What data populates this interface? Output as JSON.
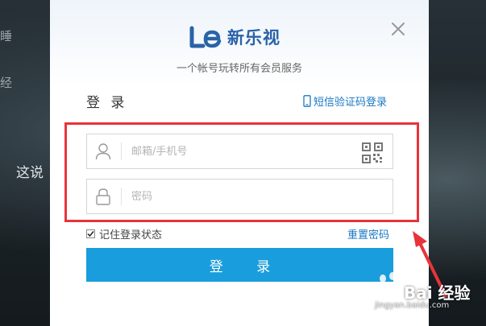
{
  "background": {
    "left_text_1": "睡",
    "left_text_2": "经",
    "subtitle": "这说"
  },
  "dialog": {
    "logo_text": "新乐视",
    "tagline": "一个帐号玩转所有会员服务",
    "login_title": "登 录",
    "sms_login": "短信验证码登录",
    "username": {
      "placeholder": "邮箱/手机号",
      "value": ""
    },
    "password": {
      "placeholder": "密码",
      "value": ""
    },
    "remember_label": "记住登录状态",
    "remember_checked": true,
    "reset_password": "重置密码",
    "login_button": "登 录"
  },
  "colors": {
    "accent": "#1a9ddc",
    "link": "#1a78c2",
    "highlight": "#e8333a",
    "brand": "#2a63a8"
  },
  "watermark": {
    "text": "Bai 经验",
    "url": "jingyan.baidu.com"
  }
}
